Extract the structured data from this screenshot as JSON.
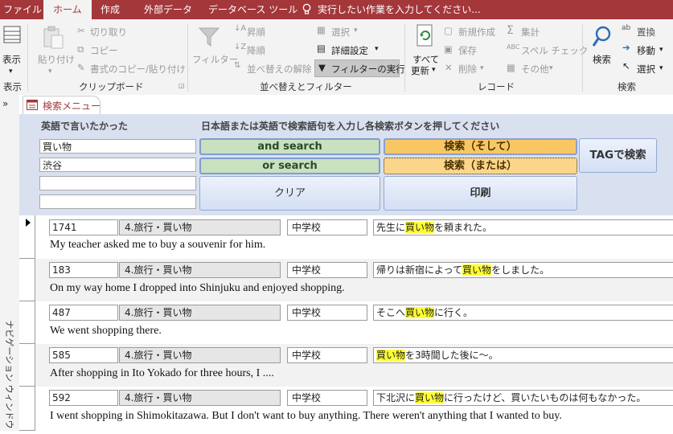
{
  "tabs": {
    "file": "ファイル",
    "home": "ホーム",
    "create": "作成",
    "external": "外部データ",
    "dbtools": "データベース ツール",
    "tellme": "実行したい作業を入力してください..."
  },
  "ribbon": {
    "view": {
      "label": "表示",
      "group": "表示"
    },
    "clipboard": {
      "paste": "貼り付け",
      "cut": "切り取り",
      "copy": "コピー",
      "format_painter": "書式のコピー/貼り付け",
      "group": "クリップボード"
    },
    "sortfilter": {
      "filter": "フィルター",
      "asc": "昇順",
      "desc": "降順",
      "clear_sort": "並べ替えの解除",
      "select": "選択",
      "advanced": "詳細設定",
      "toggle": "フィルターの実行",
      "group": "並べ替えとフィルター"
    },
    "records": {
      "refresh1": "すべて",
      "refresh2": "更新",
      "new": "新規作成",
      "save": "保存",
      "delete": "削除",
      "totals": "集計",
      "spelling": "スペル チェック",
      "more": "その他",
      "group": "レコード"
    },
    "find": {
      "find": "検索",
      "replace": "置換",
      "goto": "移動",
      "select": "選択",
      "group": "検索"
    }
  },
  "nav": {
    "label": "ナビゲーション ウィンドウ"
  },
  "doc_tab": "検索メニュー",
  "form": {
    "label_left": "英語で言いたかった",
    "label_right": "日本語または英語で検索語句を入力し各検索ボタンを押してください",
    "inputs": [
      "買い物",
      "渋谷",
      "",
      ""
    ],
    "buttons": {
      "and_search": "and search",
      "or_search": "or search",
      "search_and": "検索（そして）",
      "search_or": "検索（または）",
      "tag_search": "TAGで検索",
      "clear": "クリア",
      "print": "印刷"
    }
  },
  "records": [
    {
      "id": "1741",
      "category": "4.旅行・買い物",
      "level": "中学校",
      "jp_pre": "先生に",
      "jp_hl": "買い物",
      "jp_post": "を頼まれた。",
      "en": "My teacher asked me to buy a souvenir for him."
    },
    {
      "id": "183",
      "category": "4.旅行・買い物",
      "level": "中学校",
      "jp_pre": "帰りは新宿によって",
      "jp_hl": "買い物",
      "jp_post": "をしました。",
      "en": "On my way home I dropped into Shinjuku and enjoyed shopping."
    },
    {
      "id": "487",
      "category": "4.旅行・買い物",
      "level": "中学校",
      "jp_pre": "そこへ",
      "jp_hl": "買い物",
      "jp_post": "に行く。",
      "en": "We went shopping there."
    },
    {
      "id": "585",
      "category": "4.旅行・買い物",
      "level": "中学校",
      "jp_pre": "",
      "jp_hl": "買い物",
      "jp_post": "を3時間した後に～。",
      "en": "After shopping in Ito Yokado for three hours, I ...."
    },
    {
      "id": "592",
      "category": "4.旅行・買い物",
      "level": "中学校",
      "jp_pre": "下北沢に",
      "jp_hl": "買い物",
      "jp_post": "に行ったけど、買いたいものは何もなかった。",
      "en": "I went shopping in Shimokitazawa.  But I don't want to buy anything.  There weren't anything that I wanted to buy."
    }
  ],
  "colors": {
    "accent": "#a4373a",
    "form_bg": "#d9e1f0",
    "highlight": "#ffff33",
    "green_btn": "#c9e1bf",
    "orange_btn": "#f8c764"
  }
}
